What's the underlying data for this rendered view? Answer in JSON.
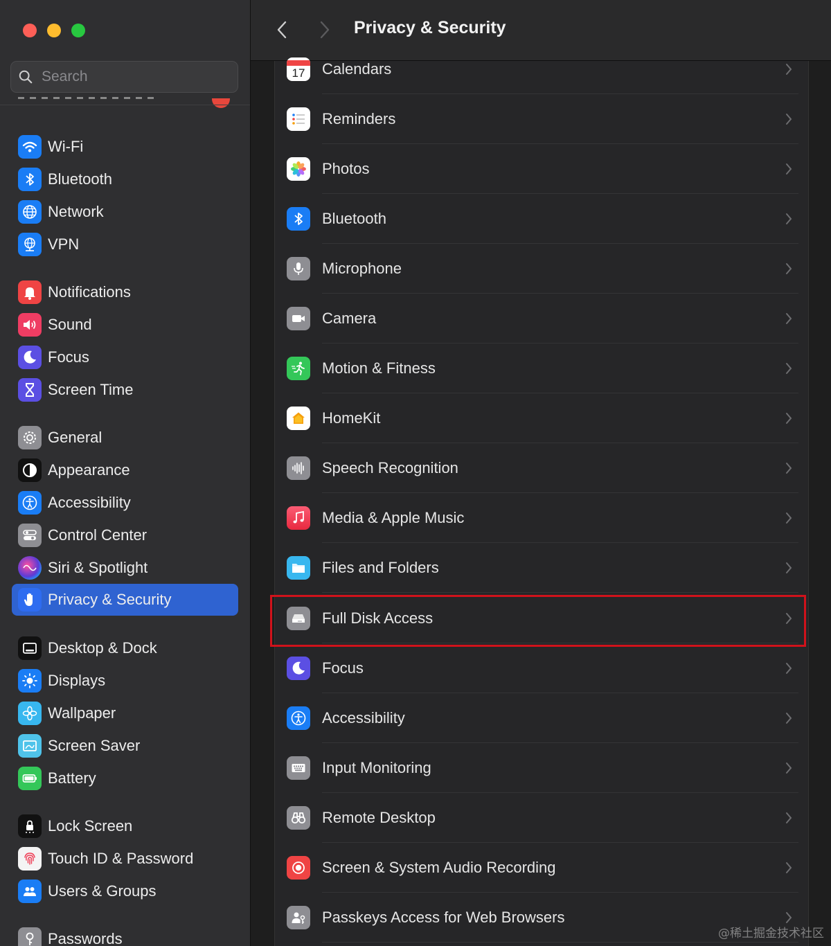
{
  "window": {
    "traffic_lights": [
      "close",
      "minimize",
      "zoom"
    ]
  },
  "search": {
    "placeholder": "Search"
  },
  "sidebar": {
    "items": [
      {
        "label": "Wi-Fi",
        "icon": "wifi-icon",
        "color": "#1a7df5"
      },
      {
        "label": "Bluetooth",
        "icon": "bluetooth-icon",
        "color": "#1a7df5"
      },
      {
        "label": "Network",
        "icon": "globe-icon",
        "color": "#1a7df5"
      },
      {
        "label": "VPN",
        "icon": "vpn-globe-icon",
        "color": "#1a7df5"
      },
      {
        "label": "Notifications",
        "icon": "bell-icon",
        "color": "#ef4444"
      },
      {
        "label": "Sound",
        "icon": "speaker-icon",
        "color": "#ef3d63"
      },
      {
        "label": "Focus",
        "icon": "moon-icon",
        "color": "#5b4fe3"
      },
      {
        "label": "Screen Time",
        "icon": "hourglass-icon",
        "color": "#5b4fe3"
      },
      {
        "label": "General",
        "icon": "gear-icon",
        "color": "#8e8e93"
      },
      {
        "label": "Appearance",
        "icon": "appearance-icon",
        "color": "#111111"
      },
      {
        "label": "Accessibility",
        "icon": "accessibility-icon",
        "color": "#1a7df5"
      },
      {
        "label": "Control Center",
        "icon": "toggles-icon",
        "color": "#8e8e93"
      },
      {
        "label": "Siri & Spotlight",
        "icon": "siri-icon",
        "color": "#3a2d6b"
      },
      {
        "label": "Privacy & Security",
        "icon": "hand-icon",
        "color": "#2e6cf0",
        "active": true
      },
      {
        "label": "Desktop & Dock",
        "icon": "dock-icon",
        "color": "#111111"
      },
      {
        "label": "Displays",
        "icon": "sun-icon",
        "color": "#1a7df5"
      },
      {
        "label": "Wallpaper",
        "icon": "flower-icon",
        "color": "#38b7ef"
      },
      {
        "label": "Screen Saver",
        "icon": "screensaver-icon",
        "color": "#4fc3ea"
      },
      {
        "label": "Battery",
        "icon": "battery-icon",
        "color": "#34c759"
      },
      {
        "label": "Lock Screen",
        "icon": "lock-icon",
        "color": "#111111"
      },
      {
        "label": "Touch ID & Password",
        "icon": "fingerprint-icon",
        "color": "#f4f4f4"
      },
      {
        "label": "Users & Groups",
        "icon": "users-icon",
        "color": "#1a7df5"
      },
      {
        "label": "Passwords",
        "icon": "key-icon",
        "color": "#8e8e93"
      }
    ]
  },
  "toolbar": {
    "back": "back-chevron-icon",
    "forward": "forward-chevron-icon",
    "title": "Privacy & Security"
  },
  "list": {
    "rows": [
      {
        "label": "Calendars",
        "icon": "calendar-icon",
        "icon_text": "17"
      },
      {
        "label": "Reminders",
        "icon": "reminders-icon"
      },
      {
        "label": "Photos",
        "icon": "photos-icon"
      },
      {
        "label": "Bluetooth",
        "icon": "bluetooth-icon"
      },
      {
        "label": "Microphone",
        "icon": "microphone-icon"
      },
      {
        "label": "Camera",
        "icon": "camera-icon"
      },
      {
        "label": "Motion & Fitness",
        "icon": "running-icon"
      },
      {
        "label": "HomeKit",
        "icon": "home-icon"
      },
      {
        "label": "Speech Recognition",
        "icon": "waveform-icon"
      },
      {
        "label": "Media & Apple Music",
        "icon": "music-note-icon"
      },
      {
        "label": "Files and Folders",
        "icon": "folder-icon"
      },
      {
        "label": "Full Disk Access",
        "icon": "disk-icon",
        "highlighted": true
      },
      {
        "label": "Focus",
        "icon": "moon-icon"
      },
      {
        "label": "Accessibility",
        "icon": "accessibility-icon"
      },
      {
        "label": "Input Monitoring",
        "icon": "keyboard-icon"
      },
      {
        "label": "Remote Desktop",
        "icon": "binoculars-icon"
      },
      {
        "label": "Screen & System Audio Recording",
        "icon": "record-icon"
      },
      {
        "label": "Passkeys Access for Web Browsers",
        "icon": "person-key-icon"
      }
    ],
    "highlight_color": "#d0121b"
  },
  "watermark": "@稀土掘金技术社区"
}
